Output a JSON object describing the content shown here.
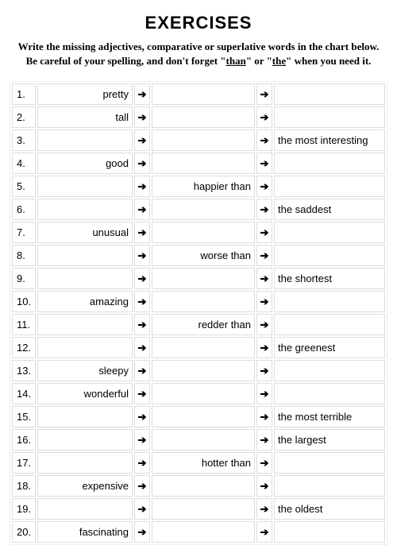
{
  "title": "EXERCISES",
  "instructions_line1": "Write the missing adjectives, comparative or superlative words in the chart below.",
  "instructions_line2_pre": "Be careful of your spelling, and don't forget \"",
  "instructions_than": "than",
  "instructions_mid": "\" or \"",
  "instructions_the": "the",
  "instructions_line2_post": "\" when you need it.",
  "arrow": "➔",
  "rows": [
    {
      "n": "1.",
      "adj": "pretty",
      "comp": "",
      "sup": ""
    },
    {
      "n": "2.",
      "adj": "tall",
      "comp": "",
      "sup": ""
    },
    {
      "n": "3.",
      "adj": "",
      "comp": "",
      "sup": "the most interesting"
    },
    {
      "n": "4.",
      "adj": "good",
      "comp": "",
      "sup": ""
    },
    {
      "n": "5.",
      "adj": "",
      "comp": "happier than",
      "sup": ""
    },
    {
      "n": "6.",
      "adj": "",
      "comp": "",
      "sup": "the saddest"
    },
    {
      "n": "7.",
      "adj": "unusual",
      "comp": "",
      "sup": ""
    },
    {
      "n": "8.",
      "adj": "",
      "comp": "worse than",
      "sup": ""
    },
    {
      "n": "9.",
      "adj": "",
      "comp": "",
      "sup": "the shortest"
    },
    {
      "n": "10.",
      "adj": "amazing",
      "comp": "",
      "sup": ""
    },
    {
      "n": "11.",
      "adj": "",
      "comp": "redder than",
      "sup": ""
    },
    {
      "n": "12.",
      "adj": "",
      "comp": "",
      "sup": "the greenest"
    },
    {
      "n": "13.",
      "adj": "sleepy",
      "comp": "",
      "sup": ""
    },
    {
      "n": "14.",
      "adj": "wonderful",
      "comp": "",
      "sup": ""
    },
    {
      "n": "15.",
      "adj": "",
      "comp": "",
      "sup": "the most terrible"
    },
    {
      "n": "16.",
      "adj": "",
      "comp": "",
      "sup": "the largest"
    },
    {
      "n": "17.",
      "adj": "",
      "comp": "hotter than",
      "sup": ""
    },
    {
      "n": "18.",
      "adj": "expensive",
      "comp": "",
      "sup": ""
    },
    {
      "n": "19.",
      "adj": "",
      "comp": "",
      "sup": "the oldest"
    },
    {
      "n": "20.",
      "adj": "fascinating",
      "comp": "",
      "sup": ""
    }
  ]
}
